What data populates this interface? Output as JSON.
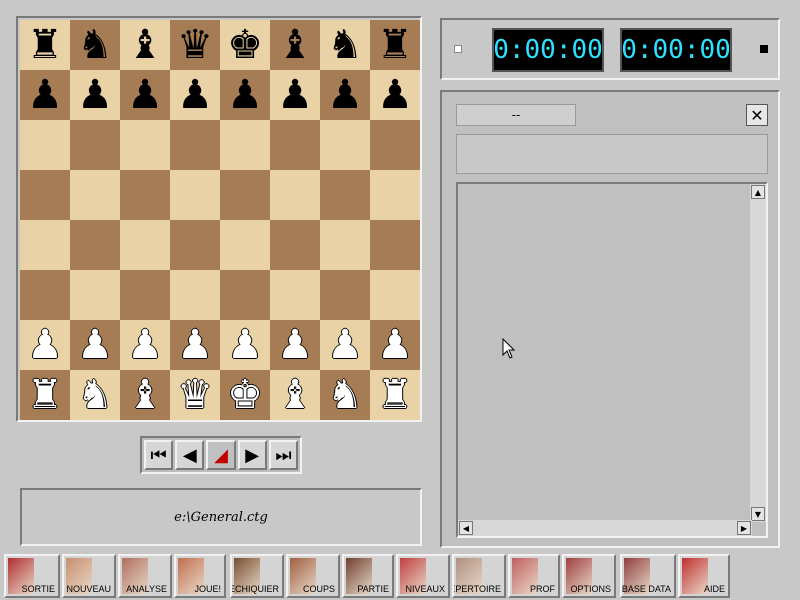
{
  "board": {
    "ranks": [
      [
        "♜",
        "♞",
        "♝",
        "♛",
        "♚",
        "♝",
        "♞",
        "♜"
      ],
      [
        "♟",
        "♟",
        "♟",
        "♟",
        "♟",
        "♟",
        "♟",
        "♟"
      ],
      [
        "",
        "",
        "",
        "",
        "",
        "",
        "",
        ""
      ],
      [
        "",
        "",
        "",
        "",
        "",
        "",
        "",
        ""
      ],
      [
        "",
        "",
        "",
        "",
        "",
        "",
        "",
        ""
      ],
      [
        "",
        "",
        "",
        "",
        "",
        "",
        "",
        ""
      ],
      [
        "♟",
        "♟",
        "♟",
        "♟",
        "♟",
        "♟",
        "♟",
        "♟"
      ],
      [
        "♜",
        "♞",
        "♝",
        "♛",
        "♚",
        "♝",
        "♞",
        "♜"
      ]
    ],
    "colors": [
      [
        "b",
        "b",
        "b",
        "b",
        "b",
        "b",
        "b",
        "b"
      ],
      [
        "b",
        "b",
        "b",
        "b",
        "b",
        "b",
        "b",
        "b"
      ],
      [
        "",
        "",
        "",
        "",
        "",
        "",
        "",
        ""
      ],
      [
        "",
        "",
        "",
        "",
        "",
        "",
        "",
        ""
      ],
      [
        "",
        "",
        "",
        "",
        "",
        "",
        "",
        ""
      ],
      [
        "",
        "",
        "",
        "",
        "",
        "",
        "",
        ""
      ],
      [
        "w",
        "w",
        "w",
        "w",
        "w",
        "w",
        "w",
        "w"
      ],
      [
        "w",
        "w",
        "w",
        "w",
        "w",
        "w",
        "w",
        "w"
      ]
    ],
    "light_color": "#e9d2a5",
    "dark_color": "#a57c54"
  },
  "navigation": {
    "first": "⏮",
    "prev": "◀",
    "play": "◢",
    "next": "▶",
    "last": "⏭"
  },
  "file": {
    "name": "e:\\General.ctg"
  },
  "clocks": {
    "white": "0:00:00",
    "black": "0:00:00",
    "digit_color": "#2fe0ff"
  },
  "notation": {
    "tab_label": "--",
    "close_label": "✕"
  },
  "toolbar": {
    "buttons": [
      {
        "id": "sortie",
        "label": "SORTIE",
        "art": "#b03030"
      },
      {
        "id": "nouveau",
        "label": "NOUVEAU",
        "art": "#c89070"
      },
      {
        "id": "analyse",
        "label": "ANALYSE",
        "art": "#b07060"
      },
      {
        "id": "joue",
        "label": "JOUE!",
        "art": "#c07050"
      },
      {
        "id": "echiquier",
        "label": "ECHIQUIER",
        "art": "#7a5030"
      },
      {
        "id": "coups",
        "label": "COUPS",
        "art": "#a06040"
      },
      {
        "id": "partie",
        "label": "PARTIE",
        "art": "#704030"
      },
      {
        "id": "niveaux",
        "label": "NIVEAUX",
        "art": "#c04040"
      },
      {
        "id": "repertoire",
        "label": "REPERTOIRE",
        "art": "#b09080"
      },
      {
        "id": "prof",
        "label": "PROF",
        "art": "#c06060"
      },
      {
        "id": "options",
        "label": "OPTIONS",
        "art": "#a04040"
      },
      {
        "id": "basedata",
        "label": "BASE DATA",
        "art": "#904040"
      },
      {
        "id": "aide",
        "label": "AIDE",
        "art": "#c03030"
      }
    ]
  }
}
